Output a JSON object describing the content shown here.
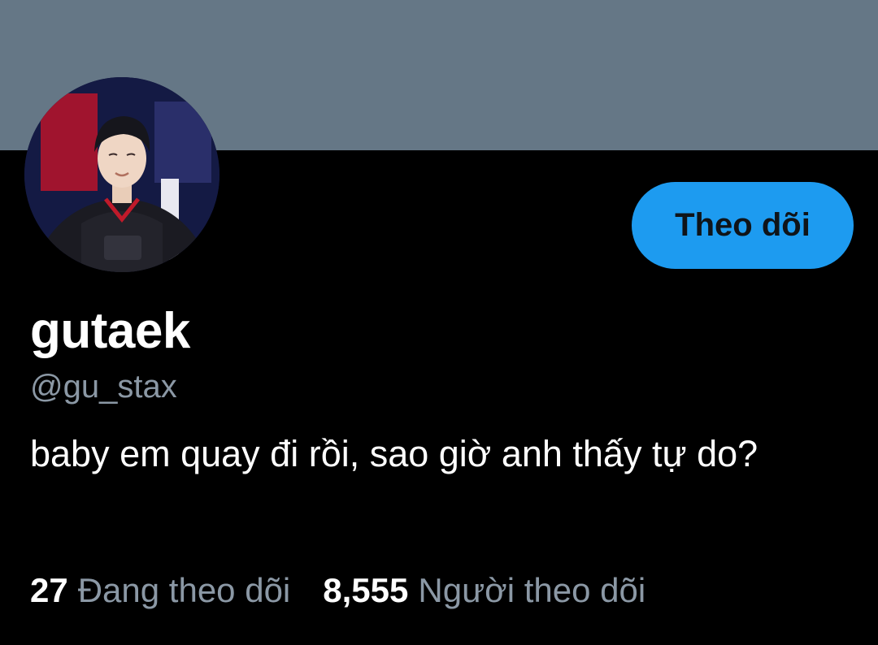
{
  "profile": {
    "display_name": "gutaek",
    "handle": "@gu_stax",
    "bio": "baby em quay đi rồi, sao giờ anh thấy tự do?",
    "avatar_icon": "profile-photo"
  },
  "actions": {
    "follow_label": "Theo dõi"
  },
  "stats": {
    "following_count": "27",
    "following_label": "Đang theo dõi",
    "followers_count": "8,555",
    "followers_label": "Người theo dõi"
  },
  "colors": {
    "banner": "#657786",
    "background": "#000000",
    "accent": "#1d9bf0",
    "muted_text": "#8b98a5"
  }
}
